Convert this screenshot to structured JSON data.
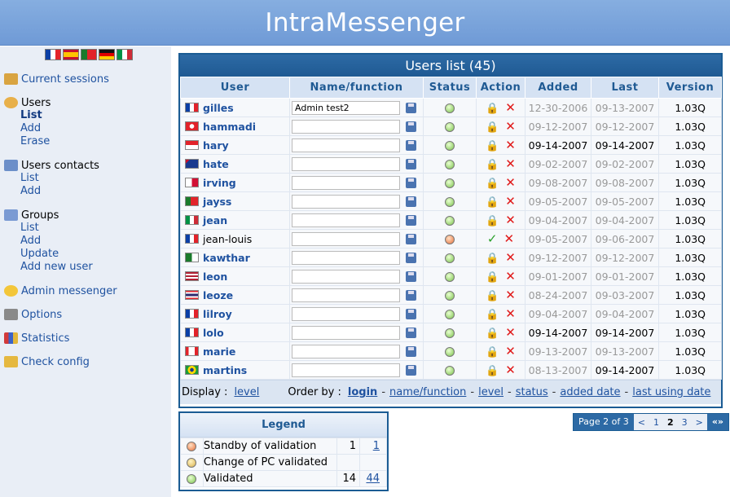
{
  "app": {
    "title": "IntraMessenger"
  },
  "sidebar": {
    "flags": [
      {
        "name": "flag-france-icon",
        "colors": [
          "#0b3fa6",
          "#ffffff",
          "#e2232a"
        ]
      },
      {
        "name": "flag-spain-icon",
        "colors": [
          "#c8102e",
          "#ffc400",
          "#c8102e"
        ]
      },
      {
        "name": "flag-portugal-icon",
        "colors": [
          "#1a7a2b",
          "#e2232a",
          "#e2232a"
        ]
      },
      {
        "name": "flag-germany-icon",
        "colors": [
          "#111111",
          "#dd0000",
          "#ffce00"
        ]
      },
      {
        "name": "flag-italy-icon",
        "colors": [
          "#009246",
          "#ffffff",
          "#ce2b37"
        ]
      }
    ],
    "current_sessions": "Current sessions",
    "users": {
      "label": "Users",
      "list": "List",
      "add": "Add",
      "erase": "Erase"
    },
    "users_contacts": {
      "label": "Users contacts",
      "list": "List",
      "add": "Add"
    },
    "groups": {
      "label": "Groups",
      "list": "List",
      "add": "Add",
      "update": "Update",
      "add_new_user": "Add new user"
    },
    "admin_messenger": "Admin messenger",
    "options": "Options",
    "statistics": "Statistics",
    "check_config": "Check config"
  },
  "users_list": {
    "title": "Users list (45)",
    "columns": {
      "user": "User",
      "name": "Name/function",
      "status": "Status",
      "action": "Action",
      "added": "Added",
      "last": "Last",
      "version": "Version"
    },
    "rows": [
      {
        "user": "gilles",
        "flag": "fr",
        "name": "Admin test2",
        "status": "validated",
        "action": "lock",
        "added": "12-30-2006",
        "last": "09-13-2007",
        "version": "1.03Q",
        "added_dark": false,
        "last_dark": false,
        "bold": true
      },
      {
        "user": "hammadi",
        "flag": "tn",
        "name": "",
        "status": "validated",
        "action": "lock",
        "added": "09-12-2007",
        "last": "09-12-2007",
        "version": "1.03Q",
        "added_dark": false,
        "last_dark": false,
        "bold": true
      },
      {
        "user": "hary",
        "flag": "id",
        "name": "",
        "status": "validated",
        "action": "lock",
        "added": "09-14-2007",
        "last": "09-14-2007",
        "version": "1.03Q",
        "added_dark": true,
        "last_dark": true,
        "bold": true
      },
      {
        "user": "hate",
        "flag": "au",
        "name": "",
        "status": "validated",
        "action": "lock",
        "added": "09-02-2007",
        "last": "09-02-2007",
        "version": "1.03Q",
        "added_dark": false,
        "last_dark": false,
        "bold": true
      },
      {
        "user": "irving",
        "flag": "pa",
        "name": "",
        "status": "validated",
        "action": "lock",
        "added": "09-08-2007",
        "last": "09-08-2007",
        "version": "1.03Q",
        "added_dark": false,
        "last_dark": false,
        "bold": true
      },
      {
        "user": "jayss",
        "flag": "pt",
        "name": "",
        "status": "validated",
        "action": "lock",
        "added": "09-05-2007",
        "last": "09-05-2007",
        "version": "1.03Q",
        "added_dark": false,
        "last_dark": false,
        "bold": true
      },
      {
        "user": "jean",
        "flag": "it",
        "name": "",
        "status": "validated",
        "action": "lock",
        "added": "09-04-2007",
        "last": "09-04-2007",
        "version": "1.03Q",
        "added_dark": false,
        "last_dark": false,
        "bold": true
      },
      {
        "user": "jean-louis",
        "flag": "fr",
        "name": "",
        "status": "standby",
        "action": "check",
        "added": "09-05-2007",
        "last": "09-06-2007",
        "version": "1.03Q",
        "added_dark": false,
        "last_dark": false,
        "bold": false
      },
      {
        "user": "kawthar",
        "flag": "dz",
        "name": "",
        "status": "validated",
        "action": "lock",
        "added": "09-12-2007",
        "last": "09-12-2007",
        "version": "1.03Q",
        "added_dark": false,
        "last_dark": false,
        "bold": true
      },
      {
        "user": "leon",
        "flag": "us",
        "name": "",
        "status": "validated",
        "action": "lock",
        "added": "09-01-2007",
        "last": "09-01-2007",
        "version": "1.03Q",
        "added_dark": false,
        "last_dark": false,
        "bold": true
      },
      {
        "user": "leoze",
        "flag": "th",
        "name": "",
        "status": "validated",
        "action": "lock",
        "added": "08-24-2007",
        "last": "09-03-2007",
        "version": "1.03Q",
        "added_dark": false,
        "last_dark": false,
        "bold": true
      },
      {
        "user": "lilroy",
        "flag": "fr",
        "name": "",
        "status": "validated",
        "action": "lock",
        "added": "09-04-2007",
        "last": "09-04-2007",
        "version": "1.03Q",
        "added_dark": false,
        "last_dark": false,
        "bold": true
      },
      {
        "user": "lolo",
        "flag": "fr",
        "name": "",
        "status": "validated",
        "action": "lock",
        "added": "09-14-2007",
        "last": "09-14-2007",
        "version": "1.03Q",
        "added_dark": true,
        "last_dark": true,
        "bold": true
      },
      {
        "user": "marie",
        "flag": "ca",
        "name": "",
        "status": "validated",
        "action": "lock",
        "added": "09-13-2007",
        "last": "09-13-2007",
        "version": "1.03Q",
        "added_dark": false,
        "last_dark": false,
        "bold": true
      },
      {
        "user": "martins",
        "flag": "br",
        "name": "",
        "status": "validated",
        "action": "lock",
        "added": "08-13-2007",
        "last": "09-14-2007",
        "version": "1.03Q",
        "added_dark": false,
        "last_dark": true,
        "bold": true
      }
    ],
    "footer": {
      "display_label": "Display :",
      "display_link": "level",
      "order_label": "Order by :",
      "order_links": [
        "login",
        "name/function",
        "level",
        "status",
        "added date",
        "last using date"
      ]
    }
  },
  "legend": {
    "title": "Legend",
    "rows": [
      {
        "label": "Standby of validation",
        "dot": "standby",
        "count": "1",
        "link": "1"
      },
      {
        "label": "Change of PC validated",
        "dot": "change",
        "count": "",
        "link": ""
      },
      {
        "label": "Validated",
        "dot": "validated",
        "count": "14",
        "link": "44"
      }
    ]
  },
  "pager": {
    "label": "Page 2 of 3",
    "prev": "<",
    "pages": [
      "1",
      "2",
      "3"
    ],
    "current": "2",
    "next": ">",
    "last": "«»"
  },
  "colors": {
    "accent": "#2d6aa5",
    "link": "#1f52a0",
    "header": "#7ba6dd"
  }
}
